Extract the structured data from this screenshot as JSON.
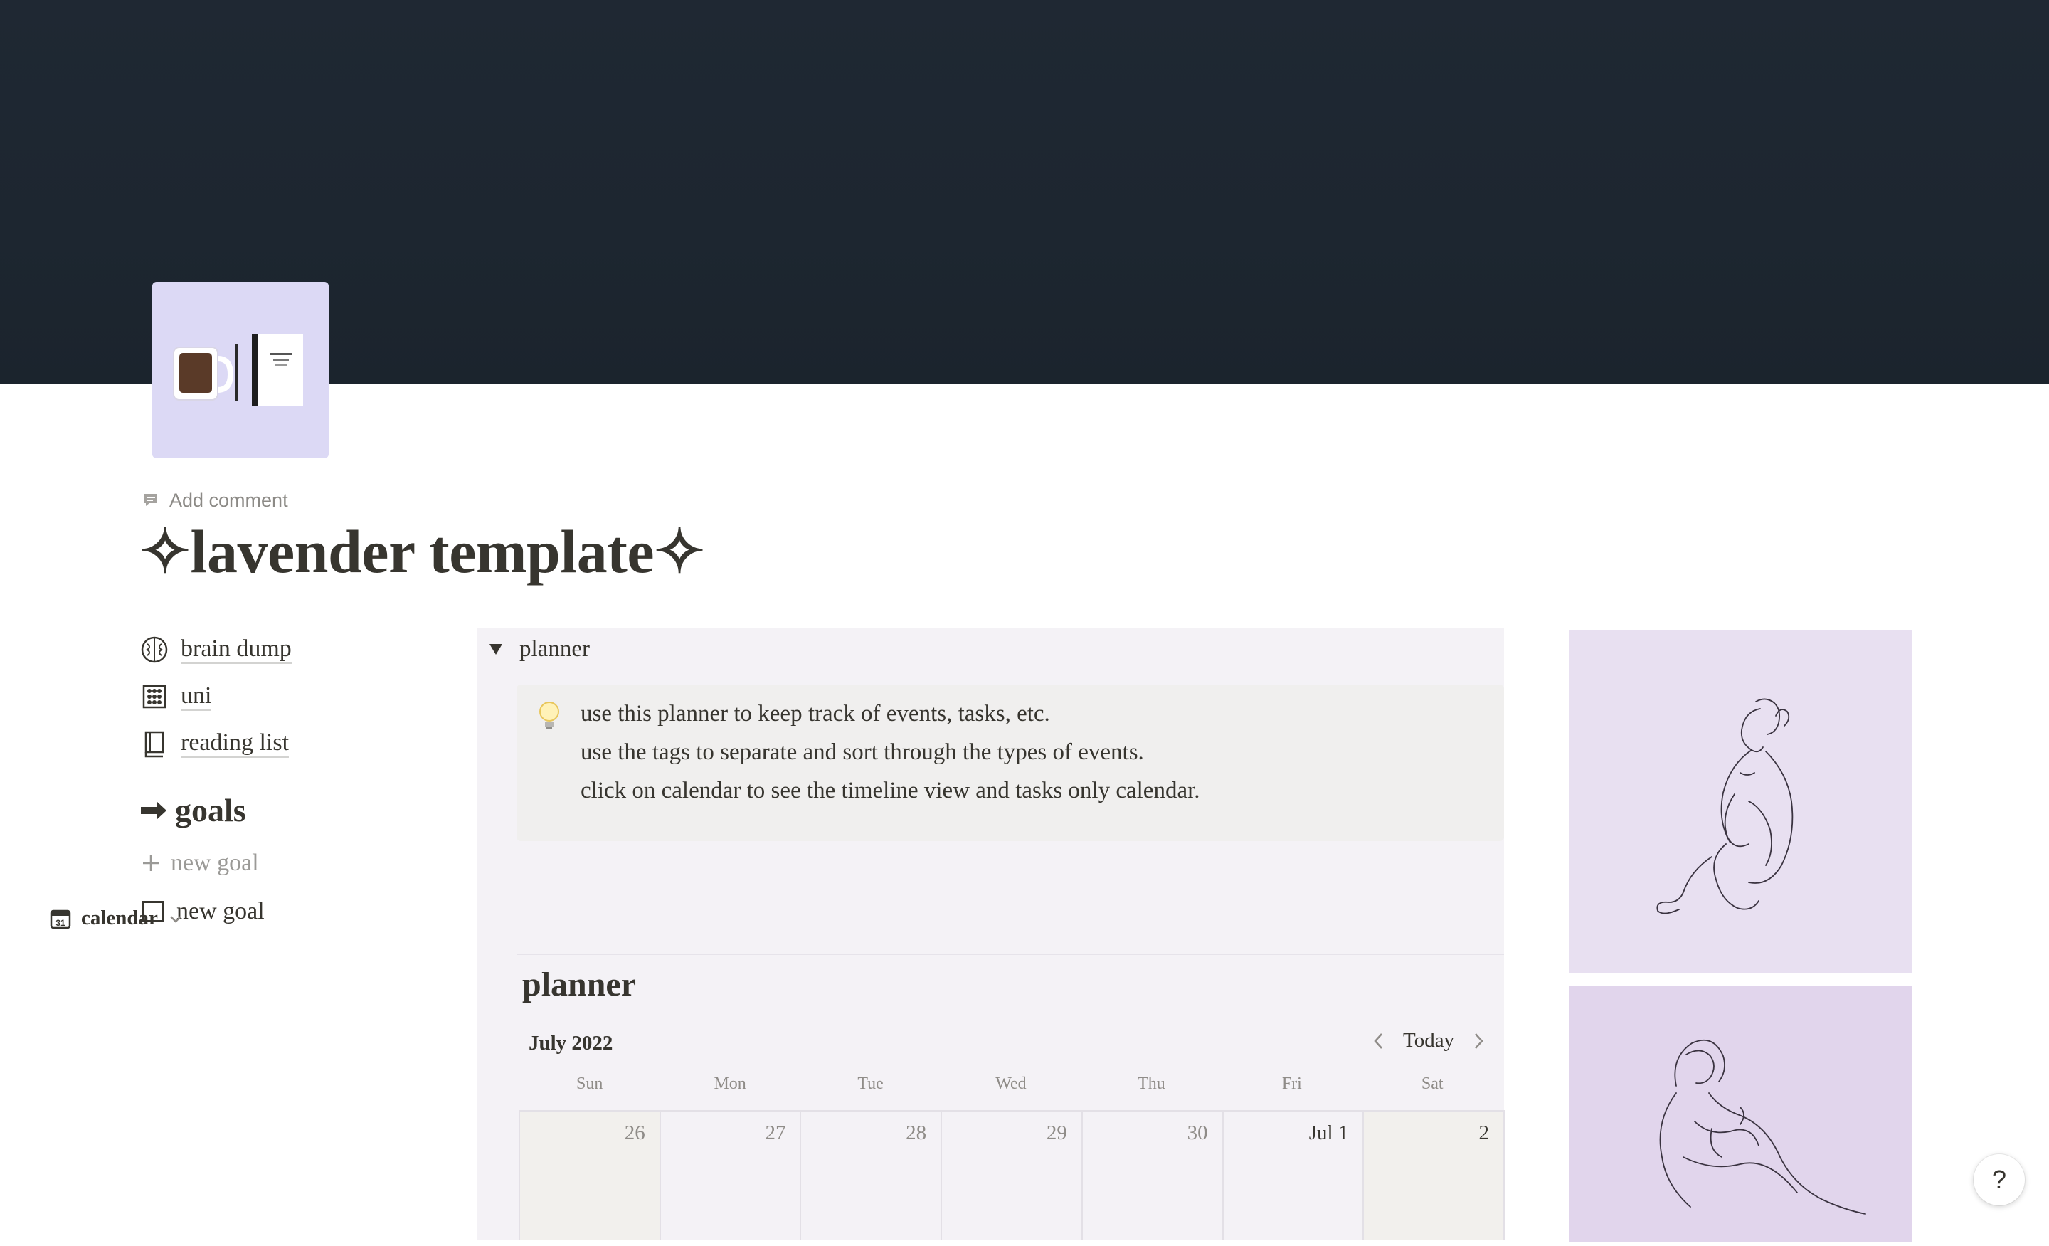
{
  "page": {
    "title": "✧lavender template✧",
    "add_comment": "Add comment"
  },
  "links": [
    {
      "label": "brain dump",
      "icon": "brain-icon"
    },
    {
      "label": "uni",
      "icon": "abacus-icon"
    },
    {
      "label": "reading list",
      "icon": "book-icon"
    }
  ],
  "goals": {
    "heading": "goals",
    "heading_icon": "arrow-right-icon",
    "add_label": "new goal",
    "item_label": "new goal"
  },
  "planner": {
    "toggle_label": "planner",
    "callout": {
      "icon": "light-bulb-icon",
      "line1": "use this planner to keep track of events, tasks, etc.",
      "line2": "use the tags to separate and sort through the types of events.",
      "line3": "click on calendar to see the timeline view and tasks only calendar."
    },
    "view_label": "calendar",
    "view_icon": "calendar-31-icon",
    "database_title": "planner",
    "month": "July 2022",
    "today_label": "Today",
    "weekdays": [
      "Sun",
      "Mon",
      "Tue",
      "Wed",
      "Thu",
      "Fri",
      "Sat"
    ],
    "days": [
      "26",
      "27",
      "28",
      "29",
      "30",
      "Jul 1",
      "2"
    ]
  },
  "help_label": "?",
  "colors": {
    "cover": "#1f2833",
    "icon_bg": "#dcd9f5",
    "panel_bg": "#f4f2f6",
    "art_bg_1": "#e8e0f1",
    "art_bg_2": "#e1d5ec",
    "text": "#37352f"
  }
}
